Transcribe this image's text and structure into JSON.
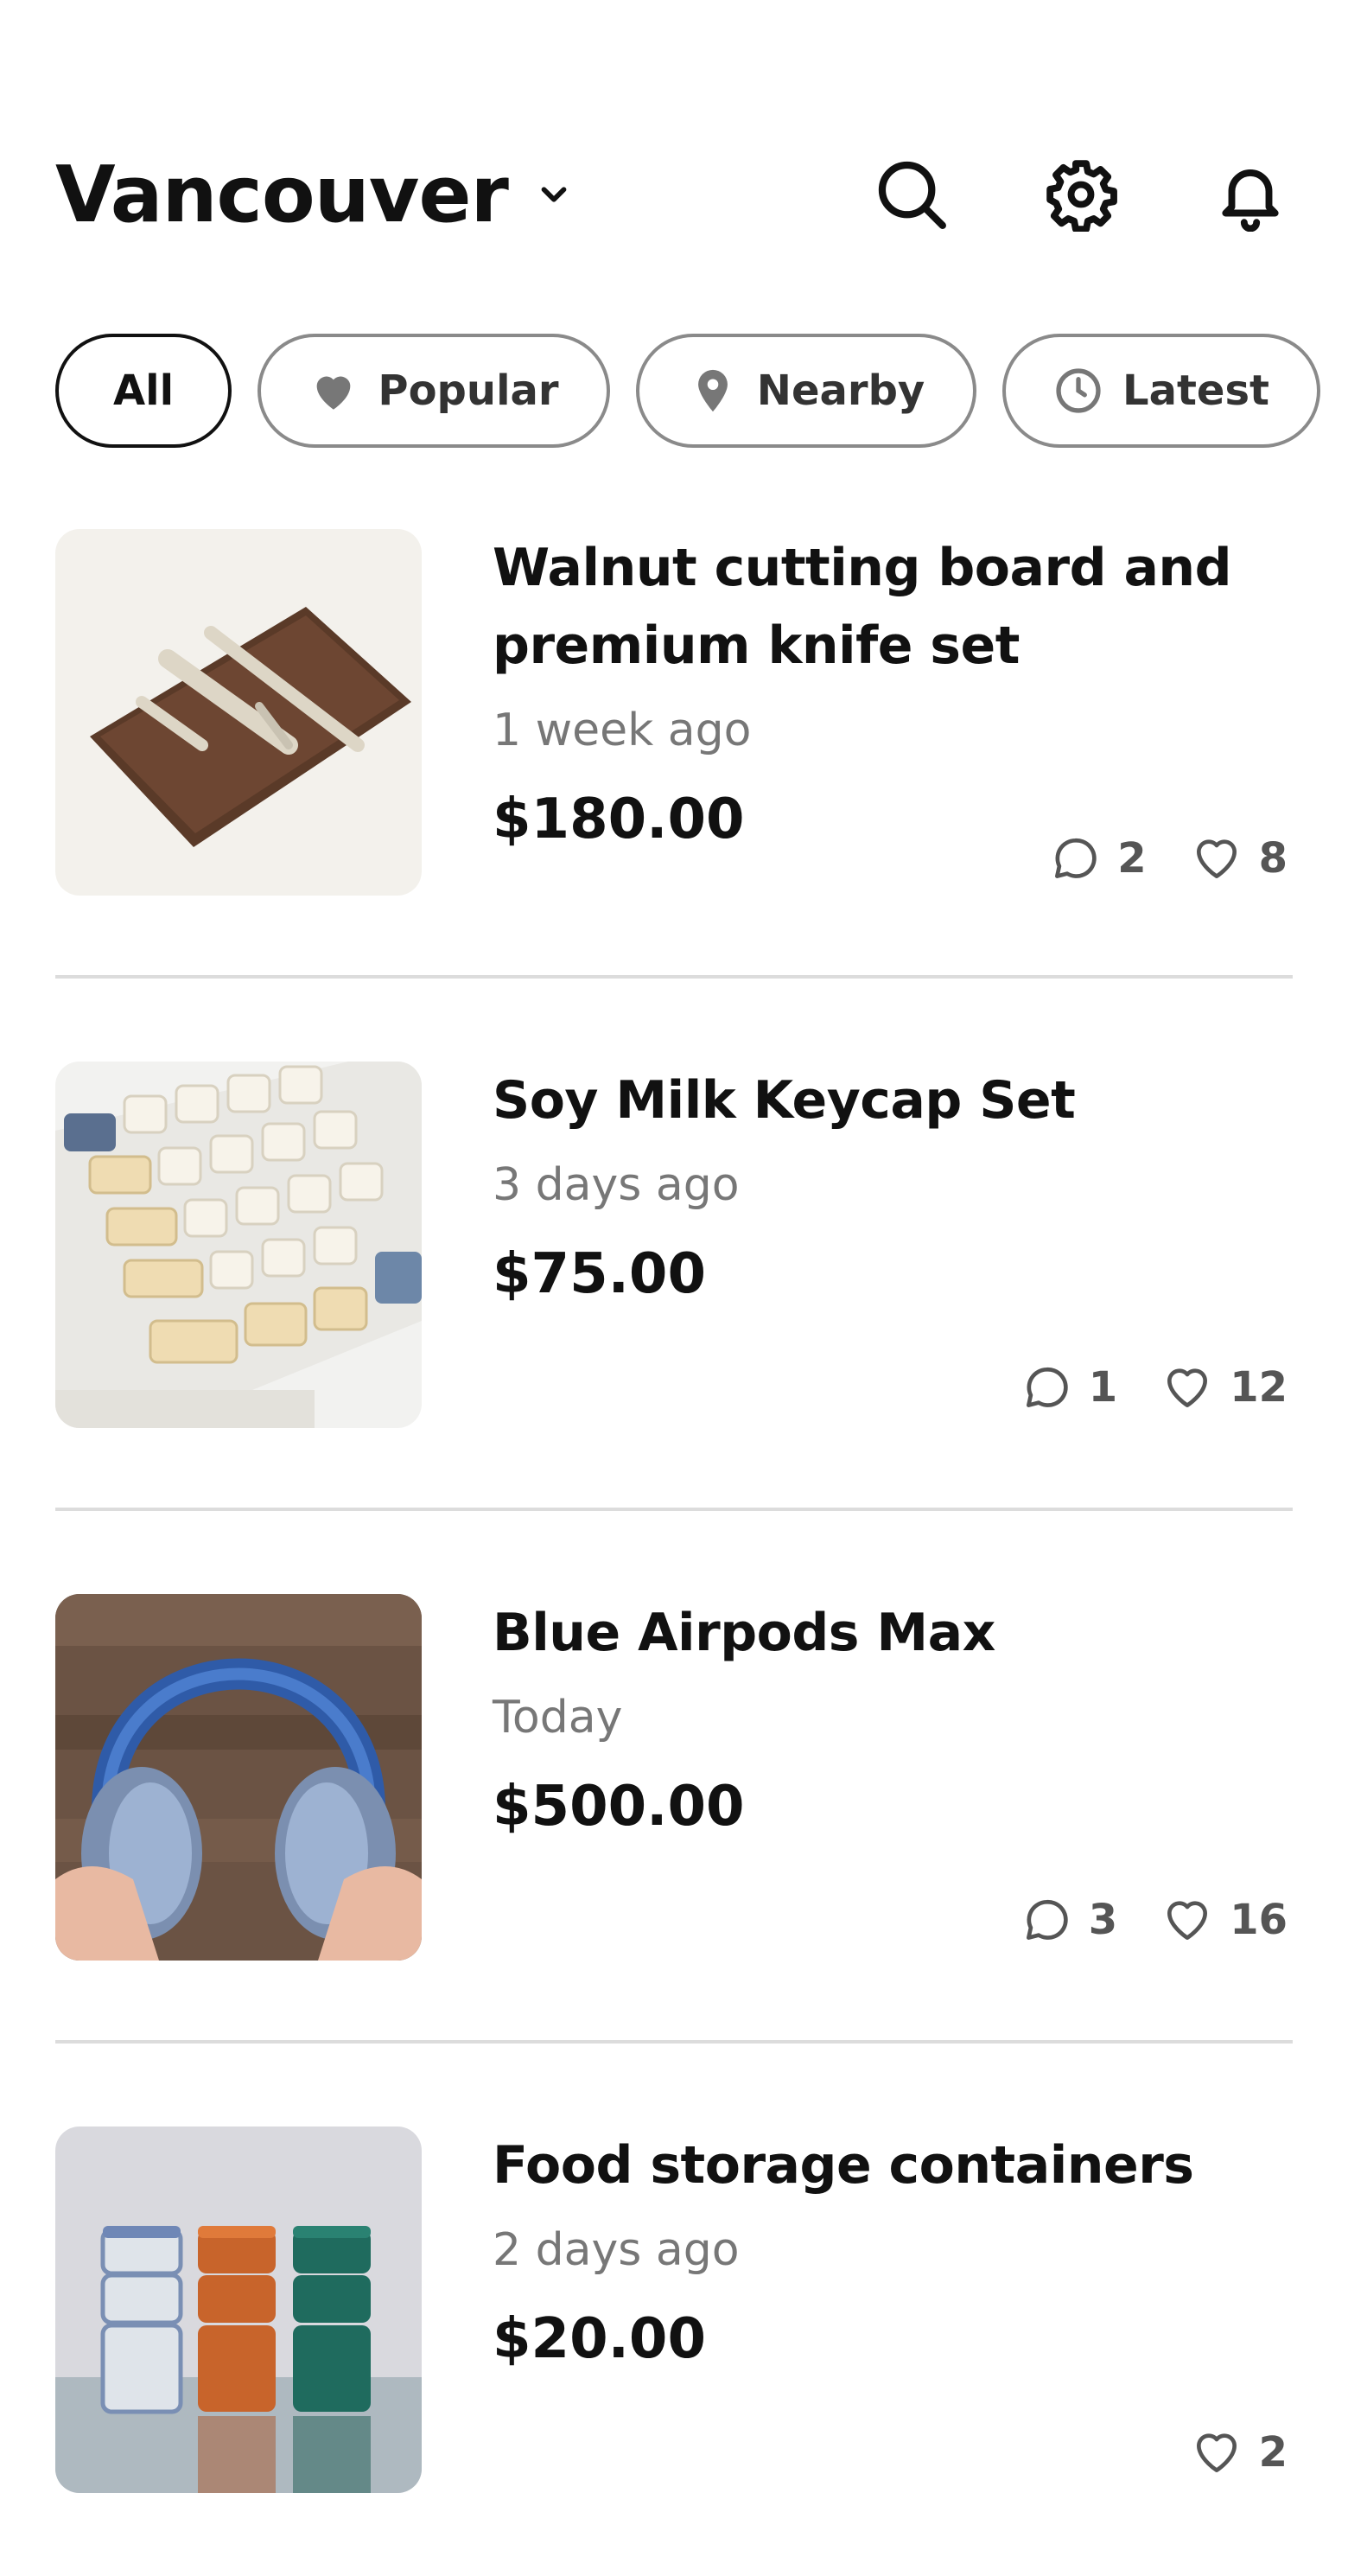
{
  "header": {
    "location": "Vancouver",
    "icons": [
      "search-icon",
      "gear-icon",
      "bell-icon"
    ]
  },
  "filters": [
    {
      "label": "All",
      "icon": null,
      "active": true
    },
    {
      "label": "Popular",
      "icon": "heart-icon",
      "active": false
    },
    {
      "label": "Nearby",
      "icon": "map-pin-icon",
      "active": false
    },
    {
      "label": "Latest",
      "icon": "clock-icon",
      "active": false
    }
  ],
  "listings": [
    {
      "title": "Walnut cutting board and premium knife set",
      "time": "1 week ago",
      "price": "$180.00",
      "comments": "2",
      "likes": "8",
      "image": "walnut board with three knives"
    },
    {
      "title": "Soy Milk Keycap Set",
      "time": "3 days ago",
      "price": "$75.00",
      "comments": "1",
      "likes": "12",
      "image": "keyboard with cream keycaps"
    },
    {
      "title": "Blue Airpods Max",
      "time": "Today",
      "price": "$500.00",
      "comments": "3",
      "likes": "16",
      "image": "hands holding blue headphones"
    },
    {
      "title": "Food storage containers",
      "time": "2 days ago",
      "price": "$20.00",
      "comments": null,
      "likes": "2",
      "image": "stacked colored containers"
    }
  ],
  "colors": {
    "text": "#111111",
    "muted": "#777777",
    "chip_border": "#8a8a8a",
    "divider": "#dcdcdc"
  }
}
